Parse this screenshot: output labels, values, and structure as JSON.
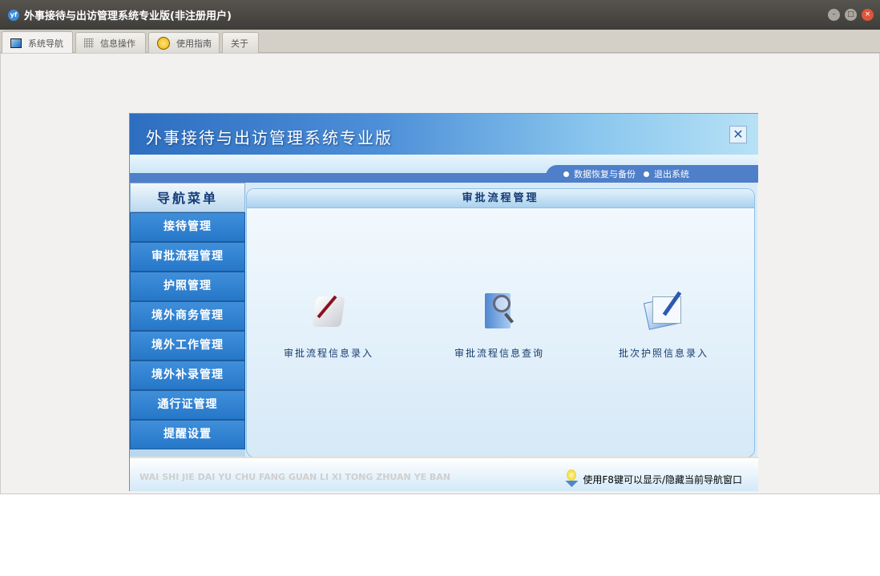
{
  "window": {
    "title": "外事接待与出访管理系统专业版(非注册用户)",
    "logo": "yf"
  },
  "tabs": [
    {
      "label": "系统导航",
      "icon": "monitor-icon"
    },
    {
      "label": "信息操作",
      "icon": "grid-icon"
    },
    {
      "label": "使用指南",
      "icon": "help-icon"
    },
    {
      "label": "关于"
    }
  ],
  "panel": {
    "title": "外事接待与出访管理系统专业版",
    "close": "✕",
    "links": [
      "数据恢复与备份",
      "退出系统"
    ]
  },
  "nav": {
    "header": "导航菜单",
    "items": [
      "接待管理",
      "审批流程管理",
      "护照管理",
      "境外商务管理",
      "境外工作管理",
      "境外补录管理",
      "通行证管理",
      "提醒设置"
    ]
  },
  "main": {
    "title": "审批流程管理",
    "functions": [
      {
        "label": "审批流程信息录入",
        "icon": "scroll-pen-icon"
      },
      {
        "label": "审批流程信息查询",
        "icon": "magnifier-doc-icon"
      },
      {
        "label": "批次护照信息录入",
        "icon": "documents-pen-icon"
      }
    ]
  },
  "footer": {
    "pinyin": "WAI SHI JIE DAI YU CHU FANG GUAN LI XI TONG ZHUAN YE BAN",
    "tip": "使用F8键可以显示/隐藏当前导航窗口"
  }
}
